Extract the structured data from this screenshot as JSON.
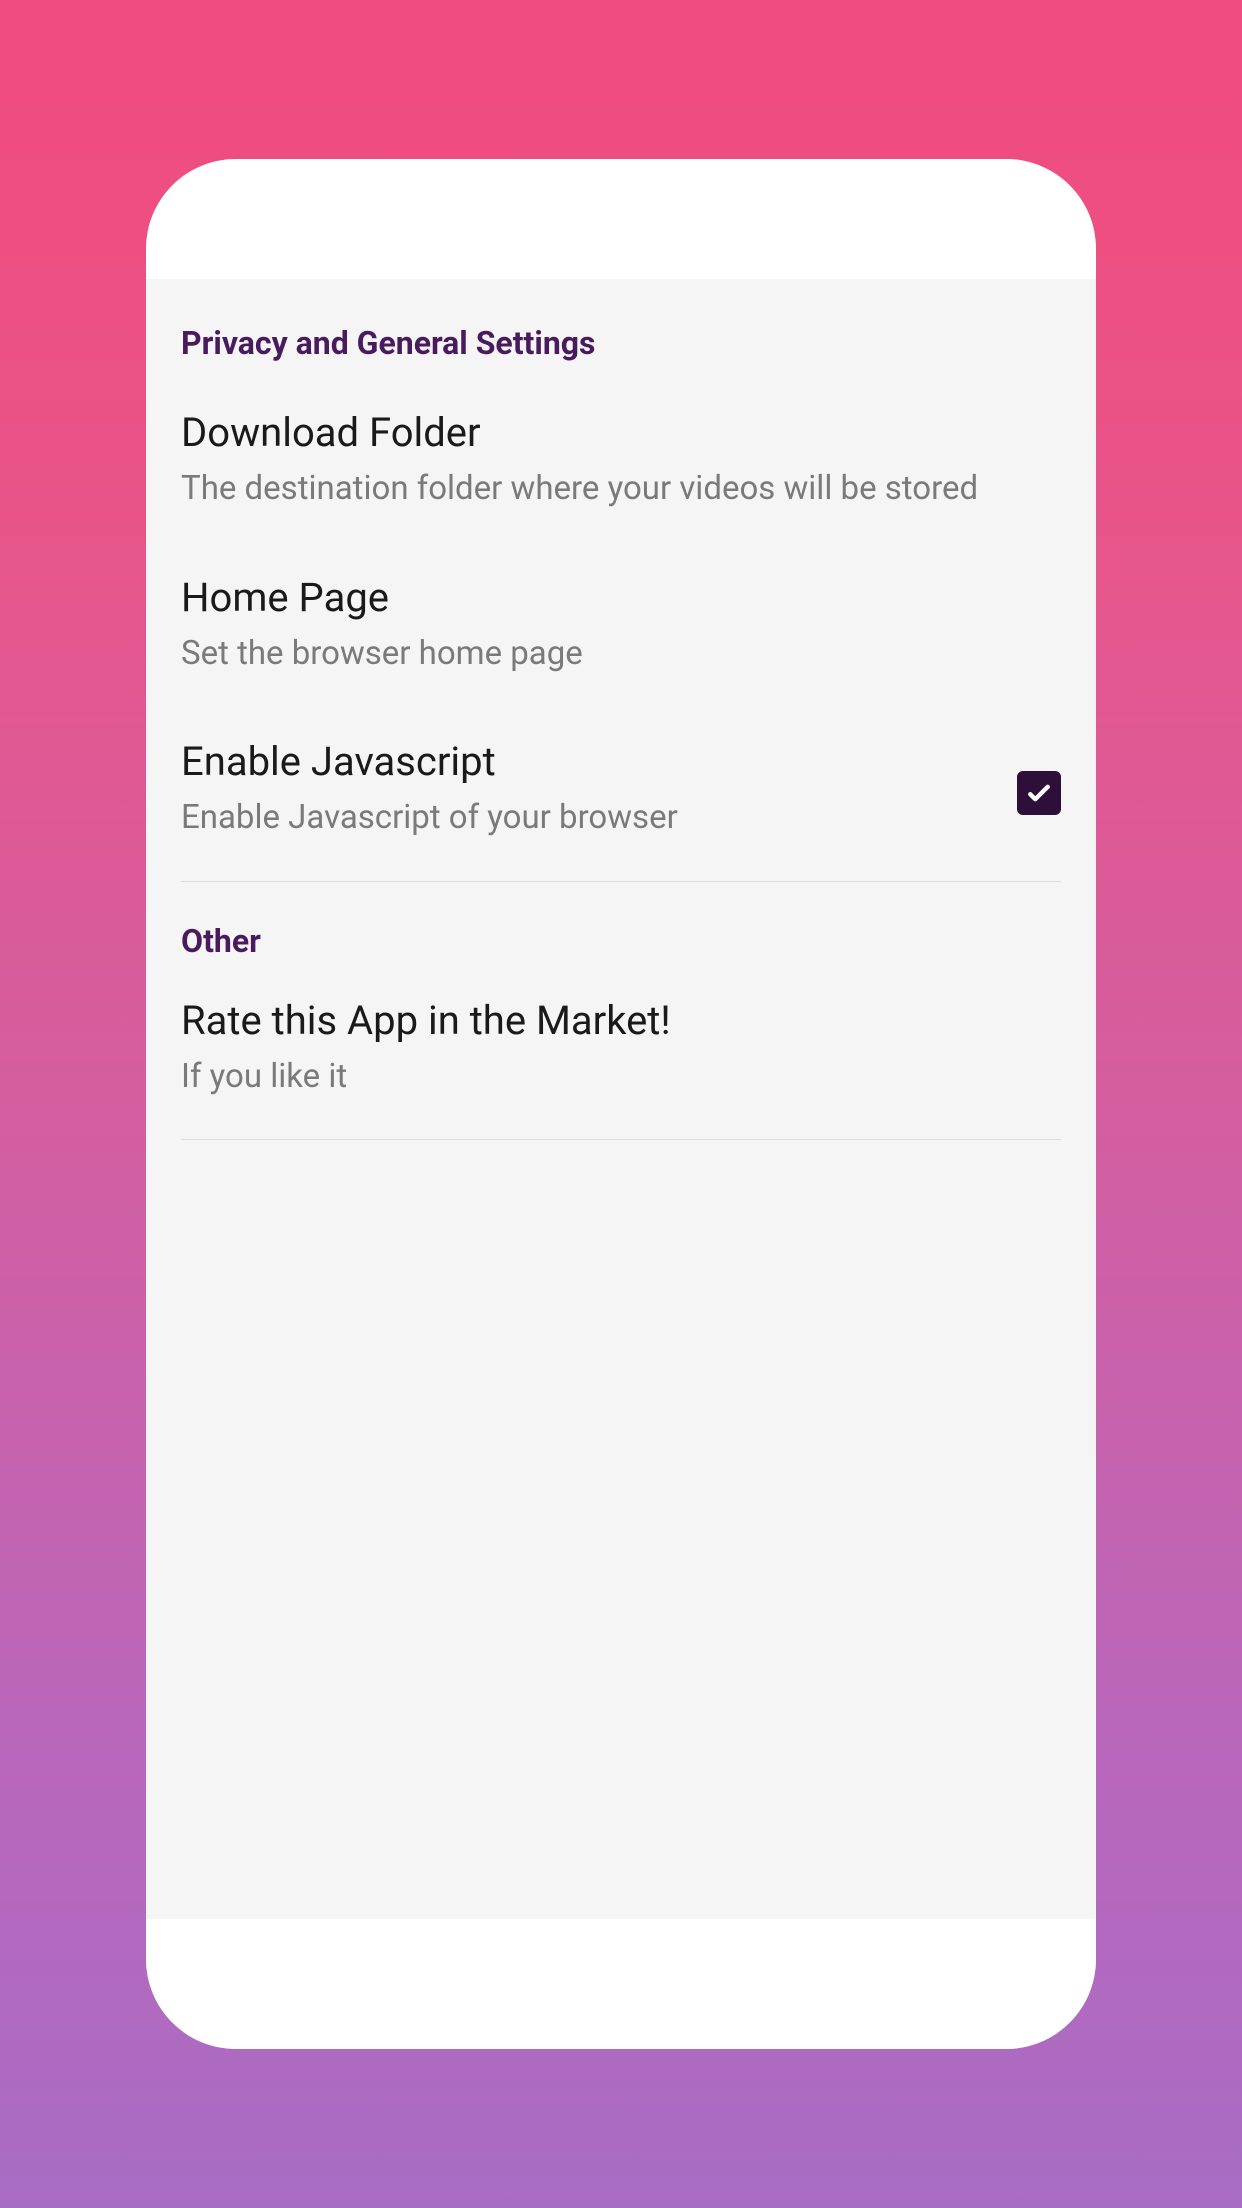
{
  "sections": {
    "privacy": {
      "header": "Privacy and General Settings",
      "items": {
        "download_folder": {
          "title": "Download Folder",
          "subtitle": "The destination folder where your videos will be stored"
        },
        "home_page": {
          "title": "Home Page",
          "subtitle": "Set the browser home page"
        },
        "enable_javascript": {
          "title": "Enable Javascript",
          "subtitle": "Enable Javascript of your browser",
          "checked": true
        }
      }
    },
    "other": {
      "header": "Other",
      "items": {
        "rate_app": {
          "title": "Rate this App in the Market!",
          "subtitle": "If you like it"
        }
      }
    }
  },
  "colors": {
    "section_header": "#4a1a5e",
    "checkbox_bg": "#2e0f3a"
  }
}
